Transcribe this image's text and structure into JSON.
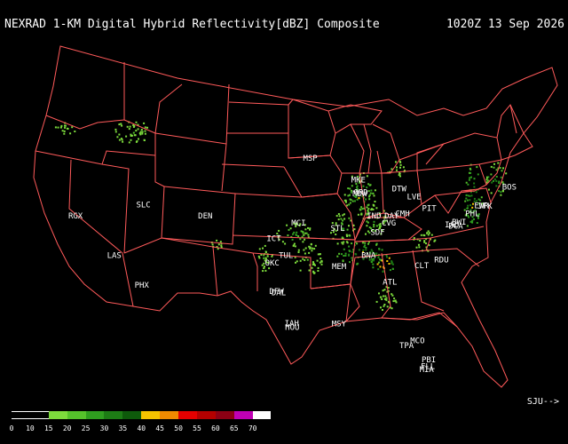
{
  "header": {
    "title": "NEXRAD 1-KM Digital Hybrid Reflectivity[dBZ] Composite",
    "timestamp": "1020Z 13 Sep 2026"
  },
  "colors": {
    "background": "#000000",
    "borders": "#ff5a5a",
    "text": "#ffffff"
  },
  "sites": [
    {
      "label": "BOS",
      "lon": -71.06,
      "lat": 42.36
    },
    {
      "label": "JFK",
      "lon": -73.78,
      "lat": 40.64
    },
    {
      "label": "EWR",
      "lon": -74.17,
      "lat": 40.69
    },
    {
      "label": "PHL",
      "lon": -75.17,
      "lat": 39.95
    },
    {
      "label": "BWI",
      "lon": -76.67,
      "lat": 39.18
    },
    {
      "label": "IAD",
      "lon": -77.46,
      "lat": 38.95
    },
    {
      "label": "DCA",
      "lon": -77.04,
      "lat": 38.85
    },
    {
      "label": "PIT",
      "lon": -80.0,
      "lat": 40.44
    },
    {
      "label": "LVE",
      "lon": -81.69,
      "lat": 41.5
    },
    {
      "label": "DTW",
      "lon": -83.35,
      "lat": 42.21
    },
    {
      "label": "CMH",
      "lon": -82.99,
      "lat": 39.96
    },
    {
      "label": "DAY",
      "lon": -84.19,
      "lat": 39.76
    },
    {
      "label": "CVG",
      "lon": -84.51,
      "lat": 39.1
    },
    {
      "label": "SDF",
      "lon": -85.76,
      "lat": 38.25
    },
    {
      "label": "IND",
      "lon": -86.16,
      "lat": 39.77
    },
    {
      "label": "MKE",
      "lon": -87.91,
      "lat": 43.04
    },
    {
      "label": "ORD",
      "lon": -87.63,
      "lat": 41.88
    },
    {
      "label": "MDW",
      "lon": -87.75,
      "lat": 41.79
    },
    {
      "label": "MSP",
      "lon": -93.27,
      "lat": 44.98
    },
    {
      "label": "STL",
      "lon": -90.2,
      "lat": 38.63
    },
    {
      "label": "MCI",
      "lon": -94.58,
      "lat": 39.1
    },
    {
      "label": "ICT",
      "lon": -97.34,
      "lat": 37.69
    },
    {
      "label": "TUL",
      "lon": -95.99,
      "lat": 36.15
    },
    {
      "label": "OKC",
      "lon": -97.52,
      "lat": 35.47
    },
    {
      "label": "MEM",
      "lon": -90.05,
      "lat": 35.15
    },
    {
      "label": "BNA",
      "lon": -86.78,
      "lat": 36.16
    },
    {
      "label": "ATL",
      "lon": -84.39,
      "lat": 33.75
    },
    {
      "label": "CLT",
      "lon": -80.84,
      "lat": 35.23
    },
    {
      "label": "RDU",
      "lon": -78.64,
      "lat": 35.78
    },
    {
      "label": "DFW",
      "lon": -97.04,
      "lat": 32.9
    },
    {
      "label": "DAL",
      "lon": -96.8,
      "lat": 32.78
    },
    {
      "label": "IAH",
      "lon": -95.34,
      "lat": 29.98
    },
    {
      "label": "HOU",
      "lon": -95.28,
      "lat": 29.65
    },
    {
      "label": "MSY",
      "lon": -90.07,
      "lat": 29.95
    },
    {
      "label": "MCO",
      "lon": -81.31,
      "lat": 28.43
    },
    {
      "label": "TPA",
      "lon": -82.53,
      "lat": 27.98
    },
    {
      "label": "PBI",
      "lon": -80.05,
      "lat": 26.68
    },
    {
      "label": "FLL",
      "lon": -80.15,
      "lat": 26.07
    },
    {
      "label": "MIA",
      "lon": -80.29,
      "lat": 25.8
    },
    {
      "label": "DEN",
      "lon": -104.99,
      "lat": 39.74
    },
    {
      "label": "SLC",
      "lon": -111.89,
      "lat": 40.76
    },
    {
      "label": "RGX",
      "lon": -119.46,
      "lat": 39.75
    },
    {
      "label": "LAS",
      "lon": -115.14,
      "lat": 36.17
    },
    {
      "label": "PHX",
      "lon": -112.07,
      "lat": 33.45
    }
  ],
  "echoes": [
    {
      "lon": -87.8,
      "lat": 42.0,
      "rx": 18,
      "ry": 26,
      "intensity": 35
    },
    {
      "lon": -86.3,
      "lat": 39.6,
      "rx": 16,
      "ry": 18,
      "intensity": 30
    },
    {
      "lon": -89.8,
      "lat": 38.9,
      "rx": 14,
      "ry": 20,
      "intensity": 30
    },
    {
      "lon": -87.5,
      "lat": 36.6,
      "rx": 30,
      "ry": 14,
      "intensity": 40
    },
    {
      "lon": -85.2,
      "lat": 35.8,
      "rx": 14,
      "ry": 12,
      "intensity": 45
    },
    {
      "lon": -95.1,
      "lat": 38.4,
      "rx": 20,
      "ry": 14,
      "intensity": 30
    },
    {
      "lon": -93.5,
      "lat": 36.1,
      "rx": 16,
      "ry": 18,
      "intensity": 25
    },
    {
      "lon": -98.5,
      "lat": 36.3,
      "rx": 10,
      "ry": 16,
      "intensity": 25
    },
    {
      "lon": -75.2,
      "lat": 41.6,
      "rx": 10,
      "ry": 40,
      "intensity": 40
    },
    {
      "lon": -72.6,
      "lat": 43.3,
      "rx": 12,
      "ry": 20,
      "intensity": 35
    },
    {
      "lon": -113.2,
      "lat": 47.7,
      "rx": 20,
      "ry": 14,
      "intensity": 25
    },
    {
      "lon": -120.6,
      "lat": 48.1,
      "rx": 12,
      "ry": 8,
      "intensity": 20
    },
    {
      "lon": -85.0,
      "lat": 32.6,
      "rx": 14,
      "ry": 14,
      "intensity": 20
    },
    {
      "lon": -80.6,
      "lat": 37.8,
      "rx": 14,
      "ry": 12,
      "intensity": 20
    },
    {
      "lon": -83.8,
      "lat": 44.3,
      "rx": 10,
      "ry": 10,
      "intensity": 20
    },
    {
      "lon": -104.0,
      "lat": 37.4,
      "rx": 8,
      "ry": 8,
      "intensity": 20
    }
  ],
  "legend": {
    "ticks": [
      "0",
      "10",
      "15",
      "20",
      "25",
      "30",
      "35",
      "40",
      "45",
      "50",
      "55",
      "60",
      "65",
      "70"
    ],
    "colors": [
      "#000000",
      "#000000",
      "#7ddc3c",
      "#55c22b",
      "#2f9e1f",
      "#1d7c15",
      "#0e5a0b",
      "#f5c400",
      "#f08a00",
      "#e40000",
      "#b40000",
      "#8c0014",
      "#c000b4",
      "#ffffff"
    ],
    "credit": "SJU-->"
  }
}
